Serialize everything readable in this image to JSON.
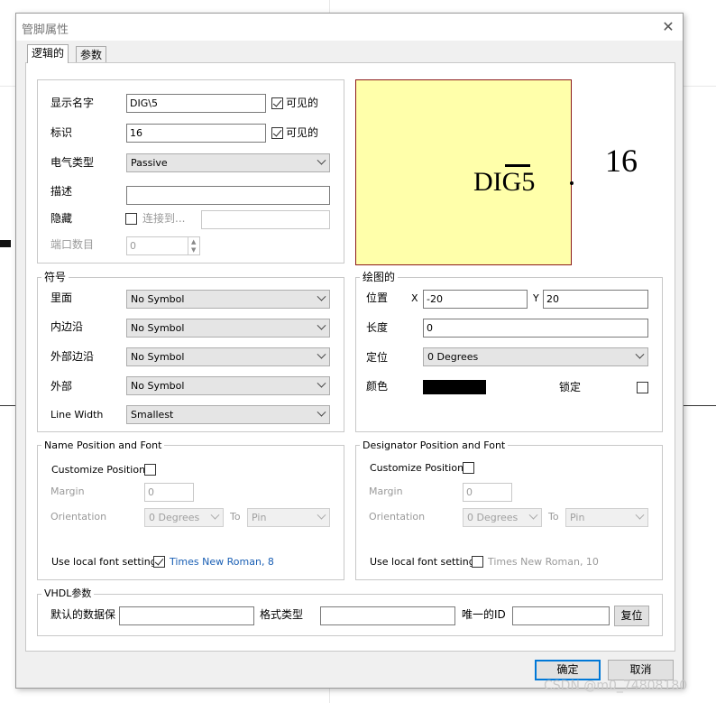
{
  "dialog": {
    "title": "管脚属性",
    "close_glyph": "✕"
  },
  "tabs": [
    {
      "label": "逻辑的"
    },
    {
      "label": "参数"
    }
  ],
  "logical": {
    "display_name": {
      "label": "显示名字",
      "value": "DIG\\5",
      "visible_label": "可见的"
    },
    "designator": {
      "label": "标识",
      "value": "16",
      "visible_label": "可见的"
    },
    "electrical_type": {
      "label": "电气类型",
      "value": "Passive"
    },
    "description": {
      "label": "描述",
      "value": ""
    },
    "hidden": {
      "label": "隐藏",
      "connect_to_label": "连接到...",
      "connect_value": ""
    },
    "port_count": {
      "label": "端口数目",
      "value": "0"
    }
  },
  "preview": {
    "pin_name": "DIG5",
    "overline_text": "G",
    "designator": "16",
    "fill_color": "#ffffaa",
    "border_color": "#8b1a1a"
  },
  "symbols": {
    "title": "符号",
    "rows": [
      {
        "label": "里面",
        "value": "No Symbol"
      },
      {
        "label": "内边沿",
        "value": "No Symbol"
      },
      {
        "label": "外部边沿",
        "value": "No Symbol"
      },
      {
        "label": "外部",
        "value": "No Symbol"
      },
      {
        "label": "Line Width",
        "value": "Smallest"
      }
    ]
  },
  "graphical": {
    "title": "绘图的",
    "location_label": "位置",
    "x_label": "X",
    "x_value": "-20",
    "y_label": "Y",
    "y_value": "20",
    "length_label": "长度",
    "length_value": "0",
    "orientation_label": "定位",
    "orientation_value": "0 Degrees",
    "color_label": "颜色",
    "color_value": "#000000",
    "locked_label": "锁定"
  },
  "name_font": {
    "title": "Name Position and Font",
    "customize_label": "Customize Position",
    "margin_label": "Margin",
    "margin_value": "0",
    "orientation_label": "Orientation",
    "orientation_value": "0 Degrees",
    "to_label": "To",
    "to_value": "Pin",
    "local_font_label": "Use local font setting",
    "font_value": "Times New Roman, 8",
    "local_font_checked": true
  },
  "designator_font": {
    "title": "Designator Position and Font",
    "customize_label": "Customize Position",
    "margin_label": "Margin",
    "margin_value": "0",
    "orientation_label": "Orientation",
    "orientation_value": "0 Degrees",
    "to_label": "To",
    "to_value": "Pin",
    "local_font_label": "Use local font setting",
    "font_value": "Times New Roman, 10",
    "local_font_checked": false
  },
  "vhdl": {
    "title": "VHDL参数",
    "default_label": "默认的数据保",
    "default_value": "",
    "format_label": "格式类型",
    "format_value": "",
    "unique_label": "唯一的ID",
    "unique_value": "",
    "reset_label": "复位"
  },
  "footer": {
    "ok_label": "确定",
    "cancel_label": "取消"
  },
  "watermark": "CSDN @m0_74808180",
  "colors": {
    "accent": "#0078d7",
    "link": "#1a5fb4"
  }
}
